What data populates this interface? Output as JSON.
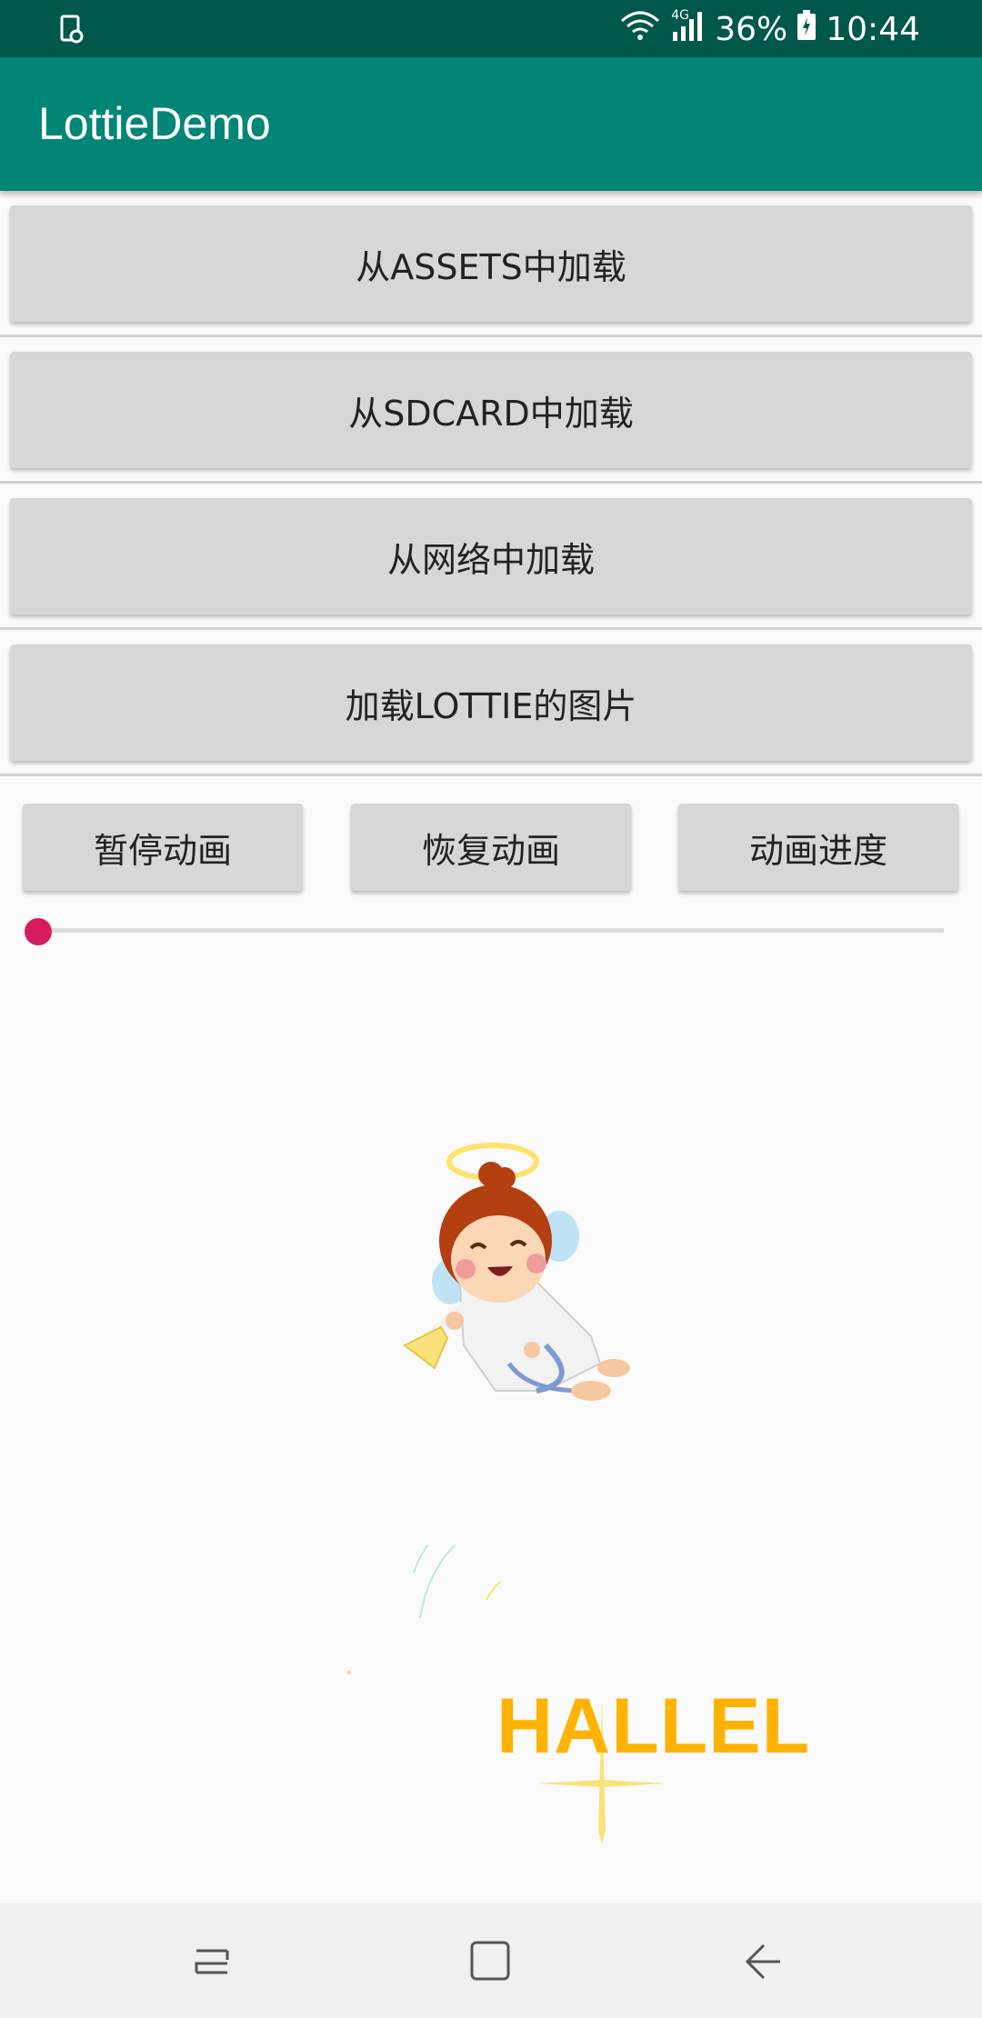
{
  "status_bar": {
    "battery": "36%",
    "time": "10:44",
    "network": "4G",
    "icons": [
      "screenshot-icon",
      "wifi-icon",
      "signal-icon",
      "battery-icon"
    ]
  },
  "app_bar": {
    "title": "LottieDemo",
    "color": "#008577"
  },
  "buttons": {
    "load_assets": "从ASSETS中加载",
    "load_sdcard": "从SDCARD中加载",
    "load_network": "从网络中加载",
    "load_lottie_images": "加载LOTTIE的图片"
  },
  "controls": {
    "pause": "暂停动画",
    "resume": "恢复动画",
    "progress": "动画进度"
  },
  "seekbar": {
    "progress": 0.0,
    "thumb_color": "#d81b60"
  },
  "animation": {
    "text": "HALLEL",
    "text_color": "#ffb300"
  },
  "nav_bar": {
    "icons": [
      "recents-icon",
      "home-icon",
      "back-icon"
    ]
  }
}
